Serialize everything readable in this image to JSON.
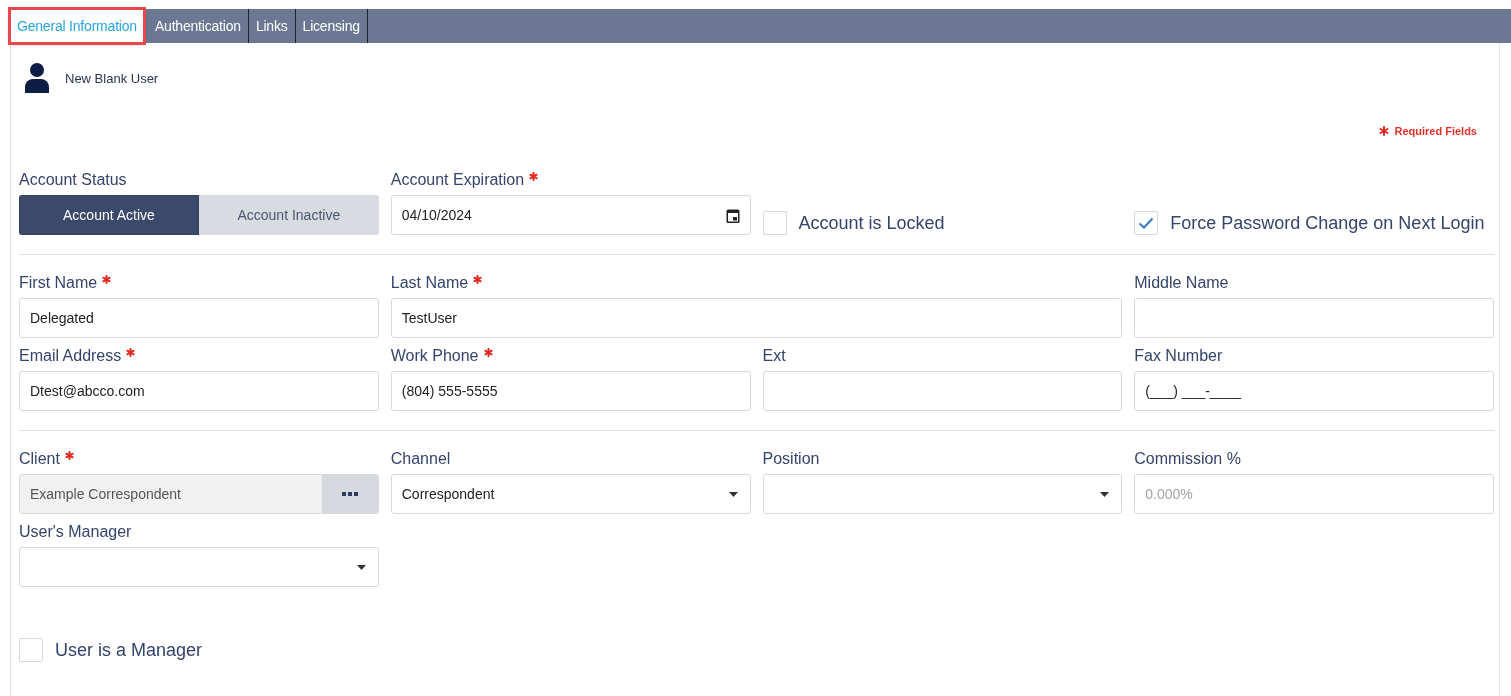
{
  "tabs": [
    {
      "label": "General Information",
      "selected": true,
      "highlighted": true
    },
    {
      "label": "Authentication",
      "selected": false,
      "highlighted": false
    },
    {
      "label": "Links",
      "selected": false,
      "highlighted": false
    },
    {
      "label": "Licensing",
      "selected": false,
      "highlighted": false
    }
  ],
  "header": {
    "title": "New Blank User"
  },
  "required_note": "Required Fields",
  "sections": [
    {
      "rows": [
        [
          {
            "kind": "toggle",
            "label": "Account Status",
            "required": false,
            "options": [
              {
                "label": "Account Active",
                "selected": true
              },
              {
                "label": "Account Inactive",
                "selected": false
              }
            ]
          },
          {
            "kind": "date",
            "label": "Account Expiration",
            "required": true,
            "value": "04/10/2024"
          },
          {
            "kind": "checkbox",
            "label": "Account is Locked",
            "checked": false
          },
          {
            "kind": "checkbox",
            "label": "Force Password Change on Next Login",
            "checked": true
          }
        ]
      ]
    },
    {
      "rows": [
        [
          {
            "kind": "text",
            "label": "First Name",
            "required": true,
            "value": "Delegated"
          },
          {
            "kind": "text",
            "label": "Last Name",
            "required": true,
            "value": "TestUser"
          },
          "",
          {
            "kind": "text",
            "label": "Middle Name",
            "required": false
          }
        ],
        [
          {
            "kind": "text",
            "label": "Email Address",
            "required": true,
            "value": "Dtest@abcco.com"
          },
          {
            "kind": "text",
            "label": "Work Phone",
            "required": true,
            "value": "(804) 555-5555"
          },
          {
            "kind": "text",
            "label": "Ext",
            "required": false
          },
          {
            "kind": "text",
            "label": "Fax Number",
            "required": false,
            "value": "(___) ___-____"
          }
        ]
      ]
    },
    {
      "rows": [
        [
          {
            "kind": "lookup",
            "label": "Client",
            "required": true,
            "value": "Example Correspondent",
            "disabled": true
          },
          {
            "kind": "select",
            "label": "Channel",
            "required": false,
            "value": "Correspondent"
          },
          {
            "kind": "select",
            "label": "Position",
            "required": false
          },
          {
            "kind": "text",
            "label": "Commission %",
            "required": false,
            "placeholder": "0.000%"
          }
        ],
        [
          {
            "kind": "select",
            "label": "User's Manager",
            "required": false
          }
        ],
        [
          {
            "kind": "checkbox",
            "label": "User is a Manager",
            "checked": false
          }
        ]
      ]
    }
  ]
}
